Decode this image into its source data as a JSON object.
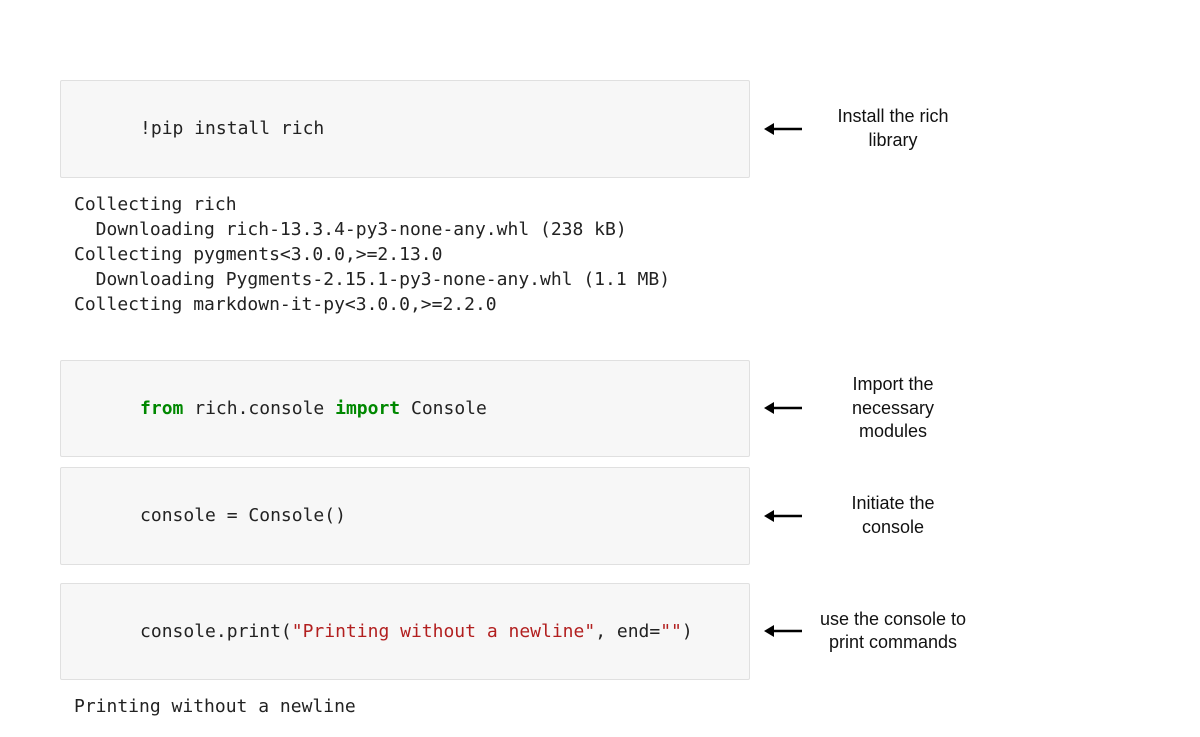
{
  "cells": {
    "install": {
      "code": "!pip install rich",
      "output": "Collecting rich\n  Downloading rich-13.3.4-py3-none-any.whl (238 kB)\nCollecting pygments<3.0.0,>=2.13.0\n  Downloading Pygments-2.15.1-py3-none-any.whl (1.1 MB)\nCollecting markdown-it-py<3.0.0,>=2.2.0",
      "annotation": "Install the rich\nlibrary"
    },
    "import": {
      "kw_from": "from",
      "module": " rich.console ",
      "kw_import": "import",
      "name": " Console",
      "annotation": "Import the\nnecessary\nmodules"
    },
    "init": {
      "code": "console = Console()",
      "annotation": "Initiate the\nconsole"
    },
    "print": {
      "prefix": "console.print(",
      "string": "\"Printing without a newline\"",
      "mid": ", end=",
      "end_arg": "\"\"",
      "suffix": ")",
      "annotation": "use the console to\nprint commands",
      "output": "Printing without a newline"
    }
  }
}
